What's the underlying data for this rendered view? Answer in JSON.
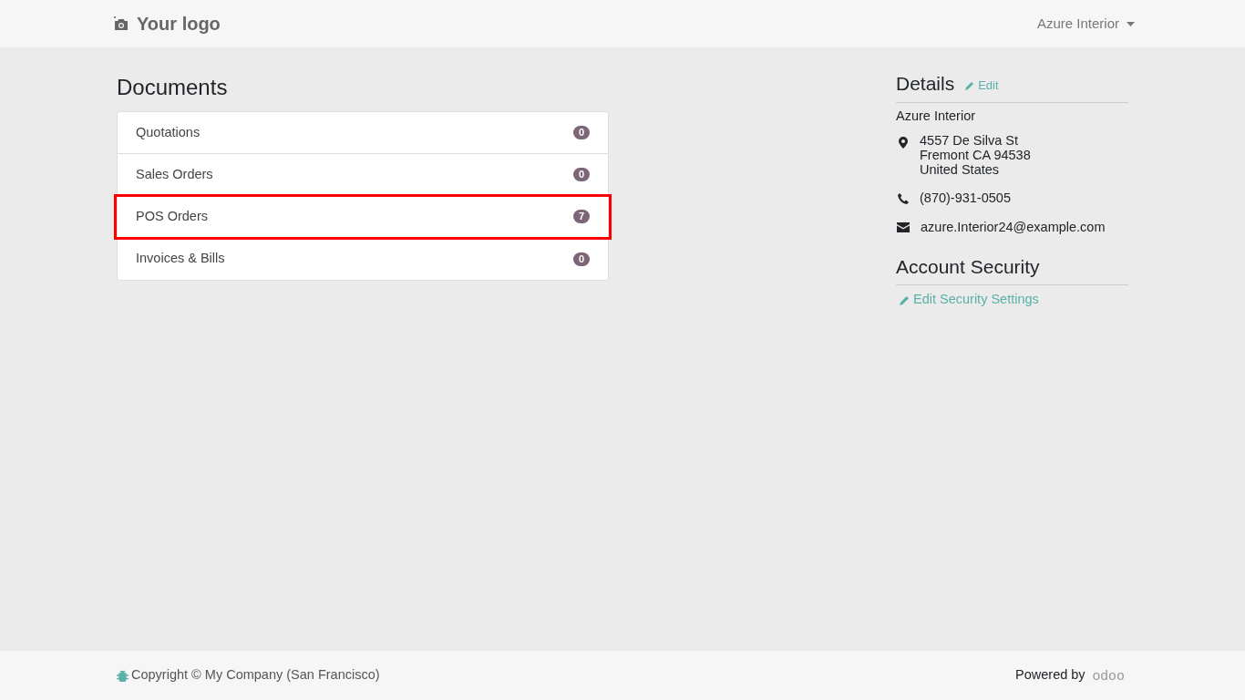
{
  "header": {
    "logo": "Your logo",
    "user_menu": "Azure Interior"
  },
  "documents": {
    "title": "Documents",
    "items": [
      {
        "label": "Quotations",
        "count": "0",
        "highlighted": false
      },
      {
        "label": "Sales Orders",
        "count": "0",
        "highlighted": false
      },
      {
        "label": "POS Orders",
        "count": "7",
        "highlighted": true
      },
      {
        "label": "Invoices & Bills",
        "count": "0",
        "highlighted": false
      }
    ]
  },
  "details": {
    "title": "Details",
    "edit_link": "Edit",
    "name": "Azure Interior",
    "address": [
      "4557 De Silva St",
      "Fremont CA 94538",
      "United States"
    ],
    "phone": "(870)-931-0505",
    "email": "azure.Interior24@example.com"
  },
  "security": {
    "title": "Account Security",
    "link": "Edit Security Settings"
  },
  "footer": {
    "copyright": "Copyright © My Company (San Francisco)",
    "powered_by": "Powered by",
    "brand": "odoo"
  }
}
